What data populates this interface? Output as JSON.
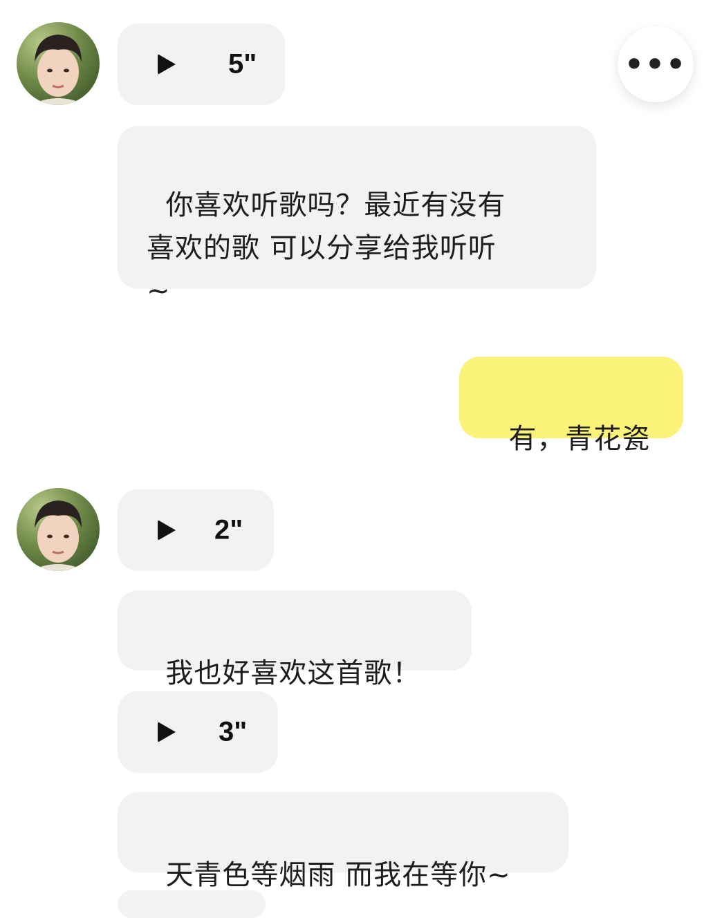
{
  "header": {
    "more_button_glyph": "•••",
    "more_icon": "more-horizontal-icon"
  },
  "messages": [
    {
      "sender": "other",
      "type": "voice",
      "duration": "5\""
    },
    {
      "sender": "other",
      "type": "text",
      "text": "你喜欢听歌吗？最近有没有\n喜欢的歌 可以分享给我听听\n~"
    },
    {
      "sender": "me",
      "type": "text",
      "text": "有，青花瓷"
    },
    {
      "sender": "other",
      "type": "voice",
      "duration": "2\""
    },
    {
      "sender": "other",
      "type": "text",
      "text": "我也好喜欢这首歌！"
    },
    {
      "sender": "other",
      "type": "voice",
      "duration": "3\""
    },
    {
      "sender": "other",
      "type": "text",
      "text": "天青色等烟雨 而我在等你~"
    }
  ],
  "colors": {
    "incoming_bubble": "#f2f2f2",
    "outgoing_bubble": "#fbf27a",
    "background": "#ffffff"
  }
}
